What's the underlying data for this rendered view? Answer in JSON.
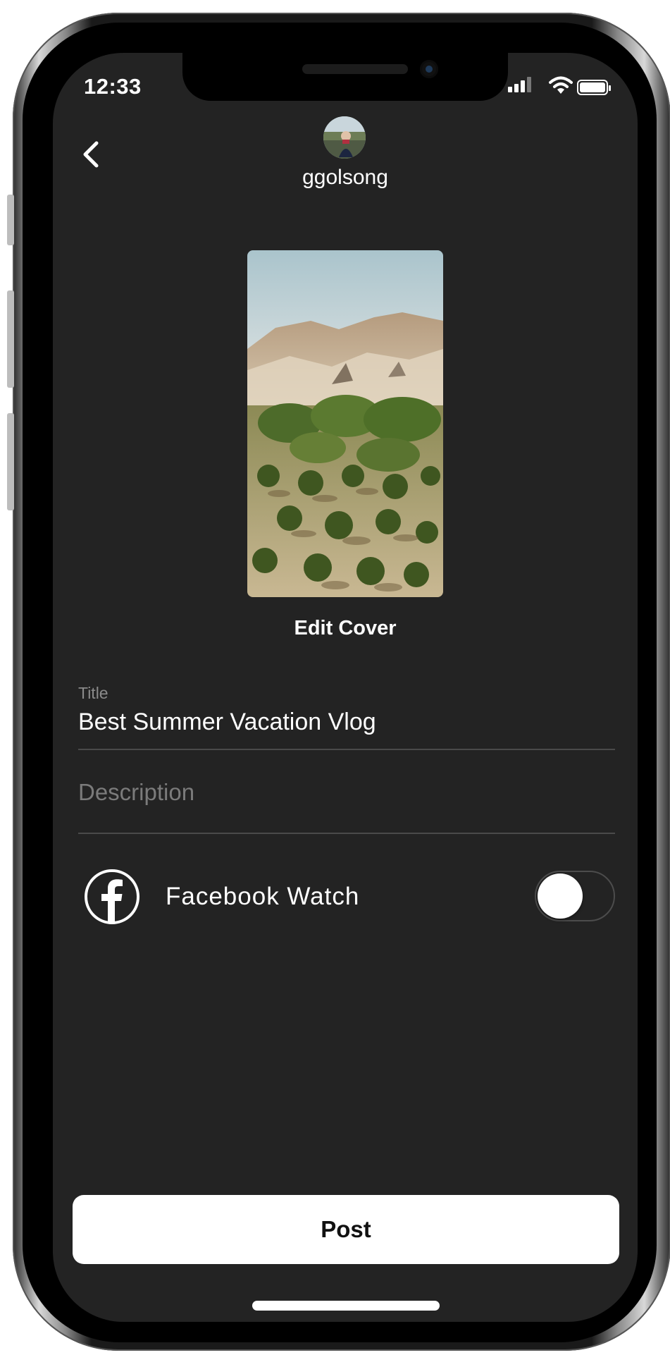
{
  "status_bar": {
    "time": "12:33"
  },
  "header": {
    "username": "ggolsong"
  },
  "cover": {
    "edit_label": "Edit Cover"
  },
  "form": {
    "title_label": "Title",
    "title_value": "Best Summer Vacation Vlog",
    "description_placeholder": "Description"
  },
  "facebook_watch": {
    "label": "Facebook Watch",
    "enabled": false
  },
  "post_button": {
    "label": "Post"
  },
  "colors": {
    "screen_background": "#232323",
    "text_primary": "#ffffff",
    "text_secondary": "#8a8a8a",
    "divider": "#4a4a4a",
    "button_background": "#ffffff"
  }
}
